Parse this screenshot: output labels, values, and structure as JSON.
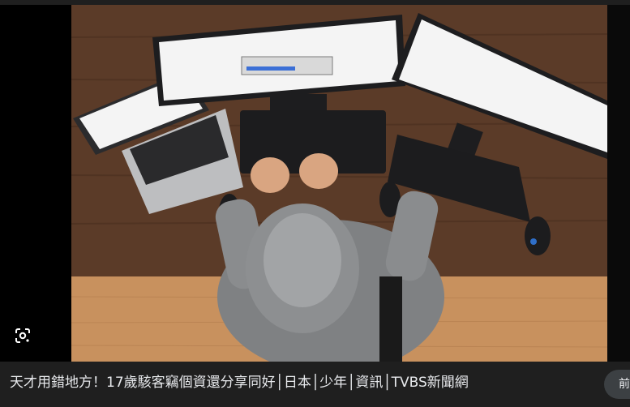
{
  "image": {
    "alt": "hooded hacker at desk with three monitors and a laptop",
    "colors": {
      "desk": "#5a3a27",
      "floor": "#c8915e",
      "hoodie": "#8a8c8e",
      "screen": "#f4f4f4",
      "device": "#1c1c1e"
    }
  },
  "lens": {
    "icon": "lens-search-icon"
  },
  "caption": {
    "title": "天才用錯地方！17歲駭客竊個資還分享同好│日本│少年│資訊│TVBS新聞網",
    "visit_label": "前往"
  }
}
